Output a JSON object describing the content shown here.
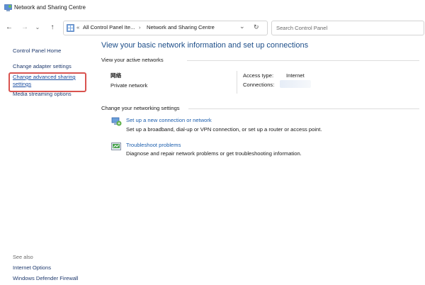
{
  "window": {
    "title": "Network and Sharing Centre"
  },
  "nav": {
    "back": "←",
    "forward": "→",
    "recent": "⌄",
    "up": "↑",
    "breadcrumb_sep": "«",
    "crumbs": [
      "All Control Panel Ite...",
      "Network and Sharing Centre"
    ],
    "crumb_arrow": "›",
    "dropdown": "⌄",
    "refresh": "↻"
  },
  "search": {
    "placeholder": "Search Control Panel"
  },
  "sidebar": {
    "items": [
      {
        "label": "Control Panel Home"
      },
      {
        "label": "Change adapter settings"
      },
      {
        "label": "Change advanced sharing"
      },
      {
        "label": "settings"
      },
      {
        "label": "Media streaming options"
      }
    ],
    "see_also": "See also",
    "see_also_items": [
      {
        "label": "Internet Options"
      },
      {
        "label": "Windows Defender Firewall"
      }
    ]
  },
  "main": {
    "title": "View your basic network information and set up connections",
    "active_networks_header": "View your active networks",
    "network": {
      "name": "网络",
      "type": "Private network",
      "access_label": "Access type:",
      "access_value": "Internet",
      "connections_label": "Connections:"
    },
    "settings_header": "Change your networking settings",
    "tasks": [
      {
        "link": "Set up a new connection or network",
        "desc": "Set up a broadband, dial-up or VPN connection, or set up a router or access point.",
        "icon": "network-setup-icon"
      },
      {
        "link": "Troubleshoot problems",
        "desc": "Diagnose and repair network problems or get troubleshooting information.",
        "icon": "troubleshoot-icon"
      }
    ]
  },
  "colors": {
    "link": "#1d5fae",
    "title": "#1d4e89",
    "highlight": "#d9534f"
  }
}
